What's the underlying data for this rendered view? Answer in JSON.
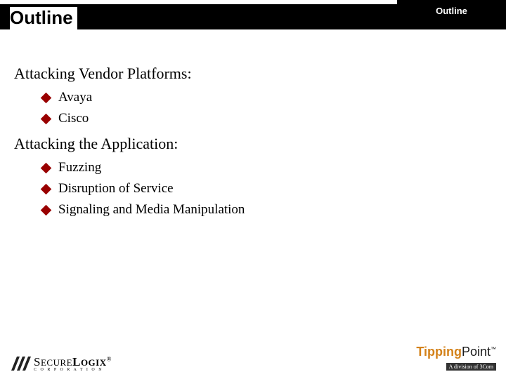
{
  "header": {
    "title": "Outline",
    "tab_label": "Outline"
  },
  "sections": [
    {
      "heading": "Attacking Vendor Platforms:",
      "items": [
        "Avaya",
        "Cisco"
      ]
    },
    {
      "heading": "Attacking the Application:",
      "items": [
        "Fuzzing",
        "Disruption of Service",
        "Signaling and Media Manipulation"
      ]
    }
  ],
  "footer": {
    "logo_left_name": "SecureLogix",
    "logo_left_sub": "C O R P O R A T I O N",
    "logo_right_part1": "Tipping",
    "logo_right_part2": "Point",
    "logo_right_sub": "A division of 3Com"
  },
  "colors": {
    "bullet": "#990000",
    "bar": "#000000",
    "tp_orange": "#d4821a"
  }
}
